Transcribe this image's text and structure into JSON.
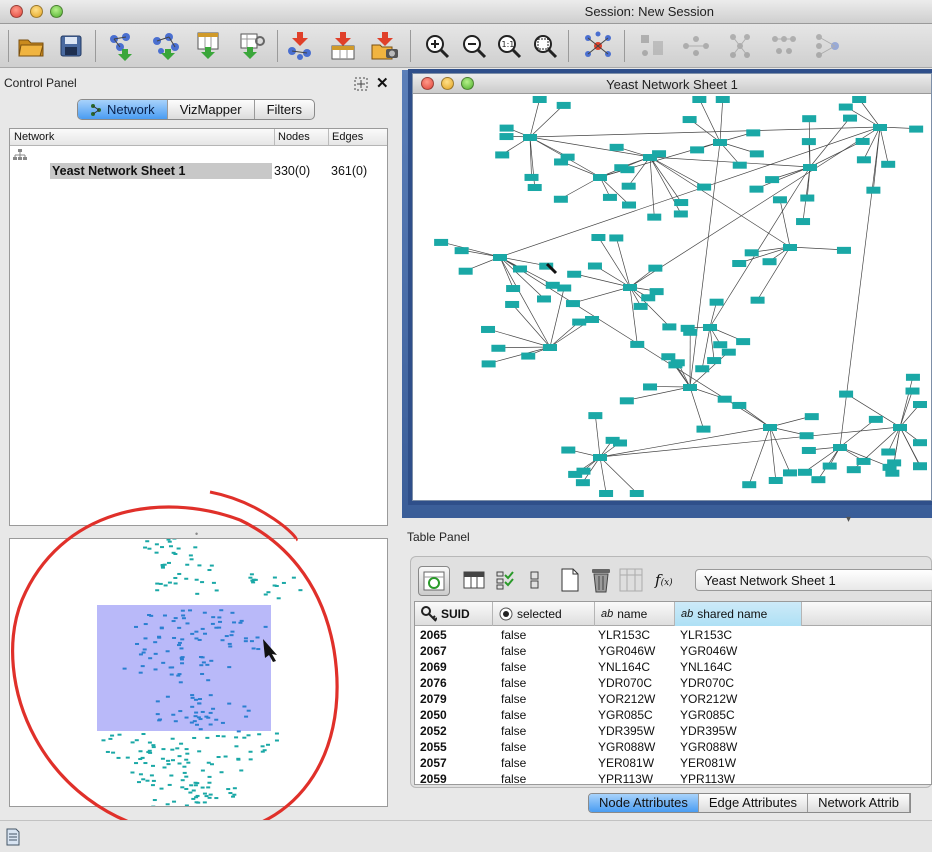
{
  "window": {
    "title": "Session: New Session"
  },
  "toolbar": {
    "icons": [
      "open-session-icon",
      "save-session-icon",
      "import-network-icon",
      "import-network-url-icon",
      "import-table-icon",
      "import-table-url-icon",
      "export-network-icon",
      "export-table-icon",
      "export-image-icon",
      "zoom-in-icon",
      "zoom-out-icon",
      "zoom-actual-icon",
      "zoom-selected-icon",
      "layout-icon",
      "network-view-1-icon",
      "network-view-2-icon",
      "network-view-3-icon",
      "network-view-4-icon",
      "network-view-5-icon"
    ]
  },
  "control_panel": {
    "label": "Control Panel",
    "tabs": [
      "Network",
      "VizMapper",
      "Filters"
    ],
    "active_tab": "Network",
    "columns": [
      "Network",
      "Nodes",
      "Edges"
    ],
    "networks": [
      {
        "name": "Yeast Network Sheet 1",
        "nodes": "330(0)",
        "edges": "361(0)"
      }
    ]
  },
  "network_view": {
    "title": "Yeast Network Sheet 1",
    "node_color": "#1aa8a6"
  },
  "table_panel": {
    "label": "Table Panel",
    "network_select": "Yeast Network Sheet 1",
    "columns": [
      "SUID",
      "selected",
      "name",
      "shared name"
    ],
    "rows": [
      {
        "suid": "2065",
        "selected": "false",
        "name": "YLR153C",
        "shared": "YLR153C"
      },
      {
        "suid": "2067",
        "selected": "false",
        "name": "YGR046W",
        "shared": "YGR046W"
      },
      {
        "suid": "2069",
        "selected": "false",
        "name": "YNL164C",
        "shared": "YNL164C"
      },
      {
        "suid": "2076",
        "selected": "false",
        "name": "YDR070C",
        "shared": "YDR070C"
      },
      {
        "suid": "2079",
        "selected": "false",
        "name": "YOR212W",
        "shared": "YOR212W"
      },
      {
        "suid": "2050",
        "selected": "false",
        "name": "YGR085C",
        "shared": "YGR085C"
      },
      {
        "suid": "2052",
        "selected": "false",
        "name": "YDR395W",
        "shared": "YDR395W"
      },
      {
        "suid": "2055",
        "selected": "false",
        "name": "YGR088W",
        "shared": "YGR088W"
      },
      {
        "suid": "2057",
        "selected": "false",
        "name": "YER081W",
        "shared": "YER081W"
      },
      {
        "suid": "2059",
        "selected": "false",
        "name": "YPR113W",
        "shared": "YPR113W"
      }
    ],
    "bottom_tabs": [
      "Node Attributes",
      "Edge Attributes",
      "Network Attrib"
    ],
    "active_bottom_tab": "Node Attributes"
  },
  "colors": {
    "accent": "#4a9cf2",
    "node": "#1aa8a6",
    "annotation": "#e0302a",
    "viewport": "#a8a8f8"
  }
}
